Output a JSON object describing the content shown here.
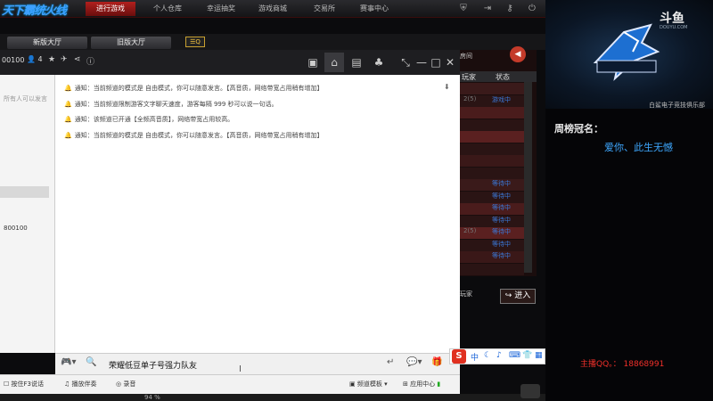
{
  "brand": {
    "logo_text": "天下霸统火线"
  },
  "topnav": [
    {
      "label": "进行游戏",
      "active": true
    },
    {
      "label": "个人仓库",
      "active": false
    },
    {
      "label": "幸运抽奖",
      "active": false
    },
    {
      "label": "游戏商城",
      "active": false
    },
    {
      "label": "交易所",
      "active": false
    },
    {
      "label": "赛事中心",
      "active": false
    }
  ],
  "topicons": [
    "shield-icon",
    "exit-icon",
    "key-icon",
    "power-icon"
  ],
  "lobby": {
    "new_hall": "新版大厅",
    "old_hall": "旧版大厅",
    "search_label": "☰Q"
  },
  "channel": {
    "id": "00100",
    "users": "4"
  },
  "toolbar_icons": [
    "video-icon",
    "home-icon",
    "list-icon",
    "gamepad-icon",
    "mute-icon",
    "minimize-icon",
    "maximize-icon",
    "close-icon"
  ],
  "left_panel": {
    "search_placeholder": "所有人可以发言",
    "number": "800100"
  },
  "messages": [
    "通知：当前频道的模式是 自由模式，你可以随意发言。【高音质，网络带宽占用稍有增加】",
    "通知：当前频道限制游客文字聊天速度，游客每隔 999 秒可以说一句话。",
    "通知：该频道已开通【全频高音质】，网络带宽占用较高。",
    "通知：当前频道的模式是 自由模式，你可以随意发言。【高音质，网络带宽占用稍有增加】"
  ],
  "right_list": {
    "top_label": "房间",
    "col_players": "玩家",
    "col_status": "状态",
    "rows": [
      {
        "players": "",
        "status": ""
      },
      {
        "players": "2(5)",
        "status": "游戏中"
      },
      {
        "players": "",
        "status": ""
      },
      {
        "players": "",
        "status": ""
      },
      {
        "players": "",
        "status": ""
      },
      {
        "players": "",
        "status": ""
      },
      {
        "players": "",
        "status": ""
      },
      {
        "players": "",
        "status": ""
      },
      {
        "players": "",
        "status": "等待中"
      },
      {
        "players": "",
        "status": "等待中"
      },
      {
        "players": "",
        "status": "等待中"
      },
      {
        "players": "",
        "status": "等待中"
      },
      {
        "players": "2(5)",
        "status": "等待中"
      },
      {
        "players": "",
        "status": "等待中"
      },
      {
        "players": "",
        "status": "等待中"
      },
      {
        "players": "",
        "status": ""
      }
    ],
    "join_label": "进入",
    "join_prefix": "玩家"
  },
  "input": {
    "text": "荣耀低豆单子号强力队友"
  },
  "ime": {
    "logo": "S",
    "lang": "中"
  },
  "bottom": {
    "push_to_talk": "按住F3说话",
    "accompany": "播放伴奏",
    "record": "录音",
    "channel_template": "频道模板",
    "app_center": "应用中心",
    "status_pct": "94 %"
  },
  "stream": {
    "douyu_logo": "斗鱼",
    "douyu_sub": "DOUYU.COM",
    "club_name": "白鲨电子竞技俱乐部",
    "weekly_label": "周榜冠名：",
    "weekly_winner": "爱你、此生无憾",
    "qq_label": "主播QQ。：  18868991"
  }
}
